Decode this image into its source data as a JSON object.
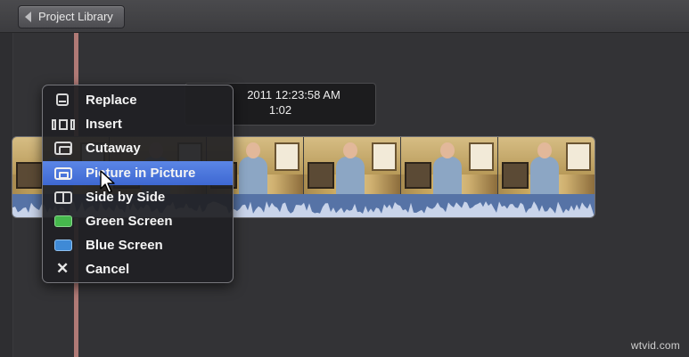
{
  "toolbar": {
    "back_label": "Project Library"
  },
  "clip_info": {
    "line1": "2011 12:23:58 AM",
    "line2": "1:02"
  },
  "context_menu": {
    "items": [
      {
        "label": "Replace",
        "icon": "replace-icon"
      },
      {
        "label": "Insert",
        "icon": "insert-icon"
      },
      {
        "label": "Cutaway",
        "icon": "cutaway-icon"
      },
      {
        "label": "Picture in Picture",
        "icon": "picture-in-picture-icon",
        "selected": true
      },
      {
        "label": "Side by Side",
        "icon": "side-by-side-icon"
      },
      {
        "label": "Green Screen",
        "icon": "green-screen-icon",
        "color": "#46b94d"
      },
      {
        "label": "Blue Screen",
        "icon": "blue-screen-icon",
        "color": "#3f8ad6"
      },
      {
        "label": "Cancel",
        "icon": "cancel-icon"
      }
    ]
  },
  "colors": {
    "selection": "#4a74dc",
    "playhead": "#b07a76",
    "audio_track": "#5673a6"
  },
  "watermark": "wtvid.com"
}
